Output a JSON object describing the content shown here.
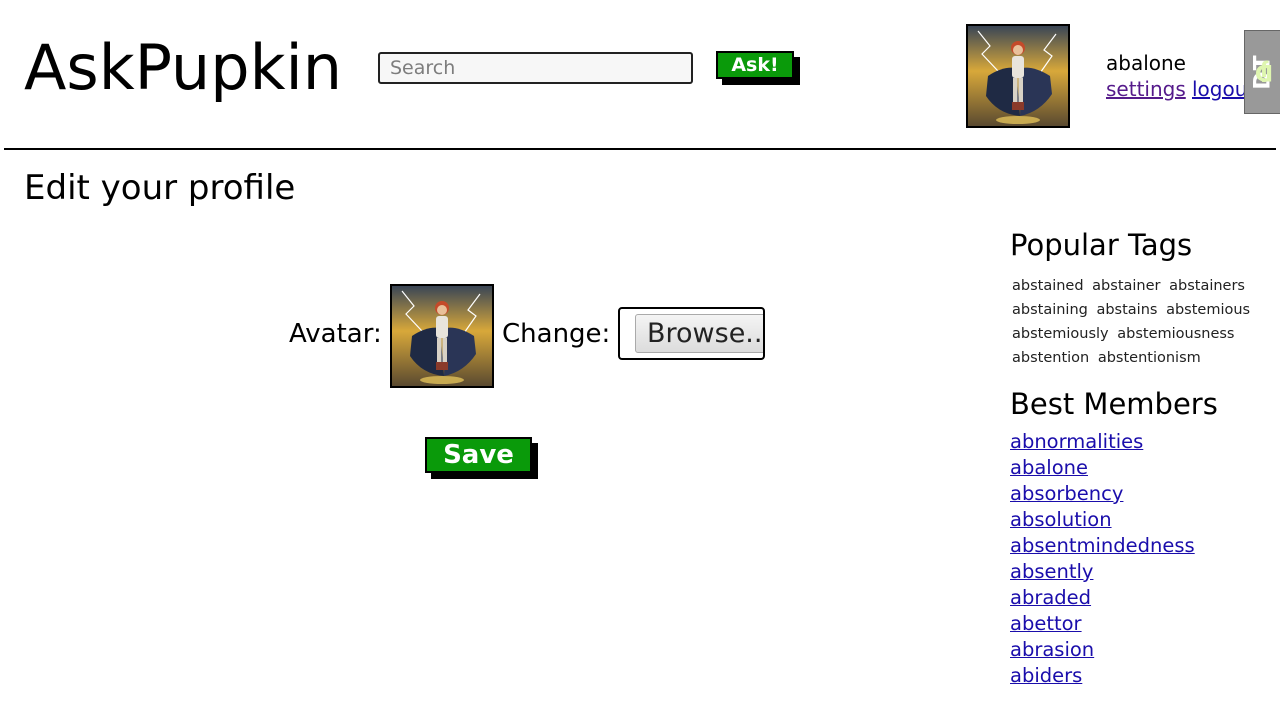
{
  "header": {
    "logo": "AskPupkin",
    "search": {
      "placeholder": "Search",
      "value": ""
    },
    "ask_label": "Ask!",
    "user": {
      "username": "abalone",
      "settings_label": "settings",
      "logout_label": "logout"
    },
    "debug_toolbar_label": "DJDT"
  },
  "main": {
    "title": "Edit your profile",
    "avatar_label": "Avatar:",
    "change_label": "Change:",
    "browse_label": "Browse...",
    "save_label": "Save"
  },
  "sidebar": {
    "tags_heading": "Popular Tags",
    "tags": [
      "abstained",
      "abstainer",
      "abstainers",
      "abstaining",
      "abstains",
      "abstemious",
      "abstemiously",
      "abstemiousness",
      "abstention",
      "abstentionism"
    ],
    "members_heading": "Best Members",
    "members": [
      "abnormalities",
      "abalone",
      "absorbency",
      "absolution",
      "absentmindedness",
      "absently",
      "abraded",
      "abettor",
      "abrasion",
      "abiders"
    ]
  },
  "colors": {
    "button_green": "#0a9a0a",
    "link_blue": "#1a0dab",
    "visited_purple": "#551a8b",
    "debug_toolbar_gray": "#999999"
  },
  "icons": {
    "avatar": "superhero-avatar-image"
  }
}
